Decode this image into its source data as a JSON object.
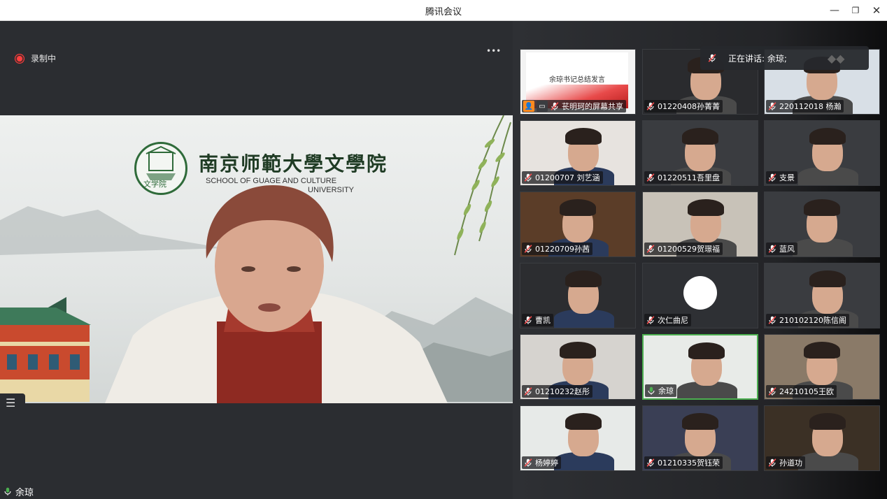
{
  "window": {
    "title": "腾讯会议"
  },
  "recording": {
    "label": "录制中"
  },
  "main_video": {
    "speaker_name": "余琼",
    "school_cn": "南京师範大學文學院",
    "school_en_line1": "SCHOOL OF      GUAGE AND CULTURE",
    "school_en_line2": "UNIVERSITY",
    "logo_text": "文学院"
  },
  "speaking_banner": {
    "text": "正在讲话: 余琼;"
  },
  "participants": [
    {
      "name": "苌明珂的屏幕共享",
      "slide_text": "余琼书记总结发言",
      "type": "share"
    },
    {
      "name": "01220408孙菁菁"
    },
    {
      "name": "220112018 杨瀚"
    },
    {
      "name": "01200707 刘艺涵"
    },
    {
      "name": "01220511吾里盘"
    },
    {
      "name": "支景"
    },
    {
      "name": "01220709孙茜"
    },
    {
      "name": "01200529贺璟福"
    },
    {
      "name": "蓝风"
    },
    {
      "name": "曹凯"
    },
    {
      "name": "次仁曲尼"
    },
    {
      "name": "210102120陈信阁"
    },
    {
      "name": "01210232赵彤"
    },
    {
      "name": "余琼",
      "active": true
    },
    {
      "name": "24210105王欧"
    },
    {
      "name": "杨婷婷"
    },
    {
      "name": "01210335贺钰荣"
    },
    {
      "name": "孙道功"
    }
  ],
  "colors": {
    "mic_muted": "#ff5050",
    "mic_active": "#4caf50",
    "record": "#ff4040"
  }
}
